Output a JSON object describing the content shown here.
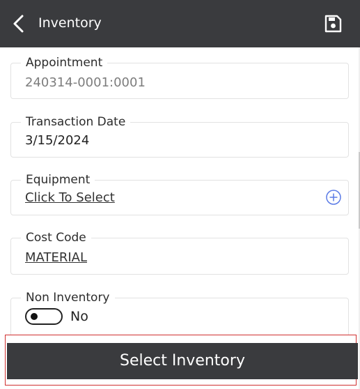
{
  "header": {
    "title": "Inventory"
  },
  "form": {
    "appointment": {
      "label": "Appointment",
      "value": "240314-0001:0001"
    },
    "transaction_date": {
      "label": "Transaction Date",
      "value": "3/15/2024"
    },
    "equipment": {
      "label": "Equipment",
      "value": "Click To Select"
    },
    "cost_code": {
      "label": "Cost Code",
      "value": "MATERIAL"
    },
    "non_inventory": {
      "label": "Non Inventory",
      "value": "No",
      "checked": false
    }
  },
  "footer": {
    "select_label": "Select Inventory"
  },
  "colors": {
    "header_bg": "#3a3b3e",
    "accent": "#5b7be6",
    "highlight_border": "#d03030"
  },
  "icons": [
    "back-arrow-icon",
    "save-icon",
    "add-circle-icon"
  ]
}
